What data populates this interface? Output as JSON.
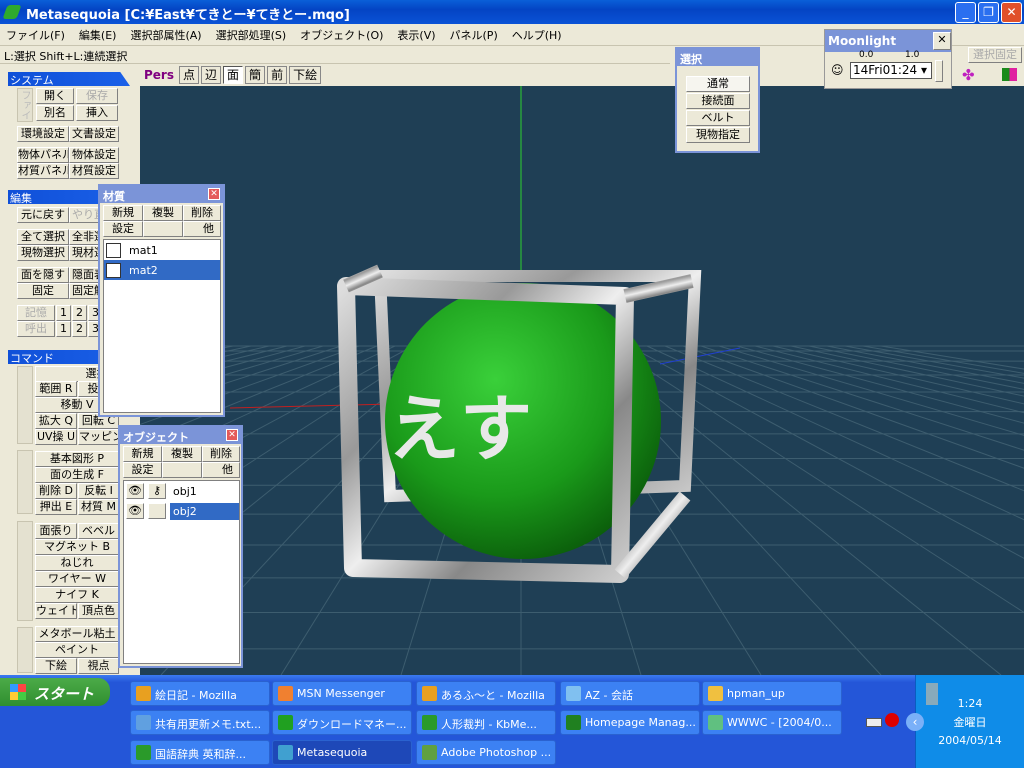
{
  "window": {
    "title": "Metasequoia [C:¥East¥てきとー¥てきとー.mqo]",
    "min": "_",
    "max": "❐",
    "close": "✕"
  },
  "menu": [
    "ファイル(F)",
    "編集(E)",
    "選択部属性(A)",
    "選択部処理(S)",
    "オブジェクト(O)",
    "表示(V)",
    "パネル(P)",
    "ヘルプ(H)"
  ],
  "status": "L:選択  Shift+L:連続選択",
  "select_lock": "選択固定",
  "view_toolbar": {
    "mode": "Pers",
    "buttons": [
      "点",
      "辺",
      "面",
      "簡",
      "前",
      "下絵"
    ],
    "active": "面"
  },
  "left_panel": {
    "system": {
      "title": "システム",
      "group": "ファイル",
      "buttons": [
        "開く",
        "保存",
        "別名",
        "挿入",
        "環境設定",
        "文書設定",
        "物体パネル",
        "物体設定",
        "材質パネル",
        "材質設定"
      ]
    },
    "edit": {
      "title": "編集",
      "buttons": [
        "元に戻す",
        "やり直し",
        "全て選択",
        "全非選択",
        "現物選択",
        "現材選択",
        "面を隠す",
        "隠面表示",
        "固定",
        "固定解除"
      ],
      "memory": "記憶",
      "recall": "呼出",
      "slots": [
        "1",
        "2",
        "3"
      ]
    },
    "command": {
      "title": "コマンド",
      "buttons": [
        "選択 S",
        "範囲 R",
        "投縄",
        "移動 V",
        "拡大 Q",
        "回転 C",
        "UV操 U",
        "マッピング",
        "基本図形 P",
        "面の生成 F",
        "削除 D",
        "反転 I",
        "押出 E",
        "材質 M",
        "面張り",
        "ベベル",
        "マグネット B",
        "ねじれ",
        "ワイヤー W",
        "ナイフ K",
        "ウェイト",
        "頂点色",
        "メタボール粘土",
        "ペイント",
        "下絵",
        "視点"
      ]
    }
  },
  "material_panel": {
    "title": "材質",
    "buttons": [
      "新規",
      "複製",
      "削除",
      "設定",
      "他"
    ],
    "items": [
      {
        "name": "mat1",
        "selected": false
      },
      {
        "name": "mat2",
        "selected": true
      }
    ]
  },
  "object_panel": {
    "title": "オブジェクト",
    "buttons": [
      "新規",
      "複製",
      "削除",
      "設定",
      "他"
    ],
    "items": [
      {
        "name": "obj1",
        "visible": true,
        "locked": true,
        "selected": false
      },
      {
        "name": "obj2",
        "visible": true,
        "locked": false,
        "selected": true
      }
    ]
  },
  "select_panel": {
    "title": "選択",
    "buttons": [
      "通常",
      "接続面",
      "ベルト",
      "現物指定"
    ],
    "active": "通常"
  },
  "moonlight": {
    "title": "Moonlight",
    "close": "✕",
    "scale_left": "0.0",
    "scale_right": "1.0",
    "value": "14Fri01:24"
  },
  "scene": {
    "text": "えす",
    "sphere_color": "#1a9a1a",
    "background": "#1f3f55"
  },
  "taskbar": {
    "start": "スタート",
    "tasks": [
      [
        "絵日記 - Mozilla",
        "MSN Messenger",
        "あるふ～と - Mozilla",
        "AZ - 会話",
        "hpman_up"
      ],
      [
        "共有用更新メモ.txt...",
        "ダウンロードマネー...",
        "人形裁判 - KbMe...",
        "Homepage Manag...",
        "WWWC - [2004/0..."
      ],
      [
        "国語辞典 英和辞...",
        "Metasequoia",
        "Adobe Photoshop ..."
      ]
    ],
    "active": "Metasequoia",
    "clock": {
      "time": "1:24",
      "day": "金曜日",
      "date": "2004/05/14"
    }
  }
}
